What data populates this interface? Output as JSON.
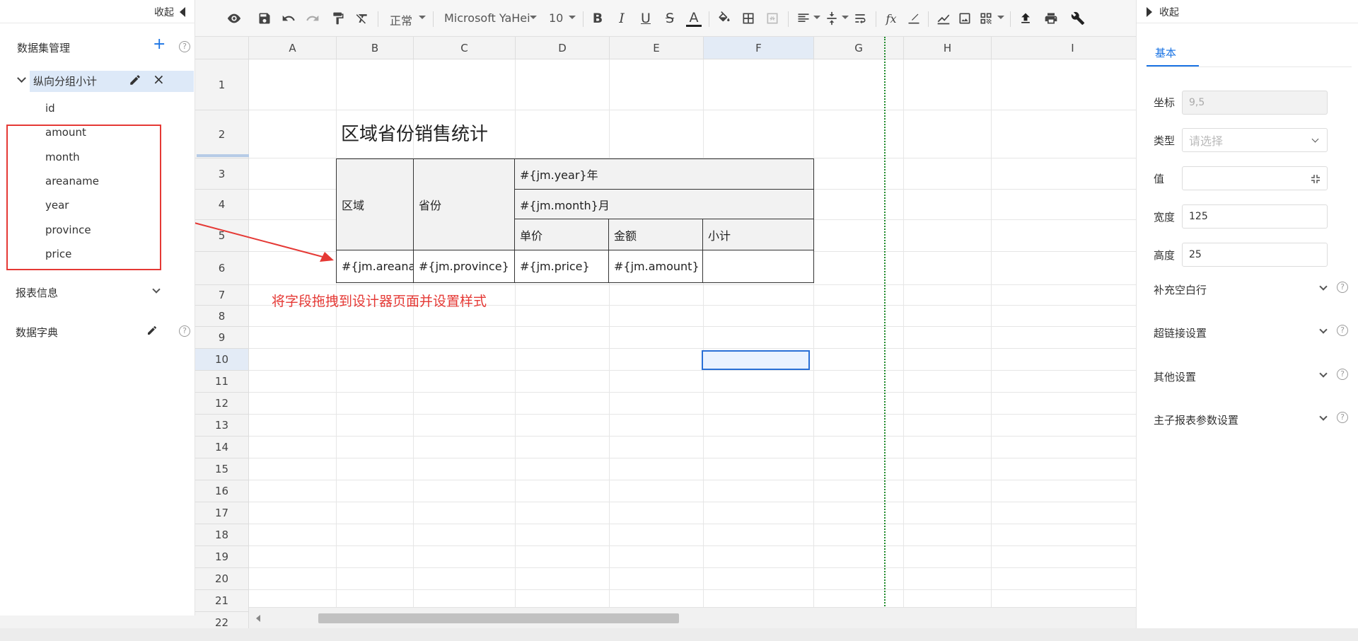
{
  "left_panel": {
    "collapse_label": "收起",
    "dataset_header": "数据集管理",
    "dataset_name": "纵向分组小计",
    "fields": [
      "id",
      "amount",
      "month",
      "areaname",
      "year",
      "province",
      "price"
    ],
    "report_info": "报表信息",
    "data_dictionary": "数据字典"
  },
  "toolbar": {
    "style_select": "正常",
    "font_select": "Microsoft YaHei",
    "size_select": "10"
  },
  "sheet": {
    "columns": [
      "A",
      "B",
      "C",
      "D",
      "E",
      "F",
      "G",
      "H",
      "I"
    ],
    "rows": [
      "1",
      "2",
      "3",
      "4",
      "5",
      "6",
      "7",
      "8",
      "9",
      "10",
      "11",
      "12",
      "13",
      "14",
      "15",
      "16",
      "17",
      "18",
      "19",
      "20",
      "21",
      "22"
    ],
    "selected_column": "F",
    "selected_row": "10",
    "title": "区域省份销售统计",
    "header_area": "区域",
    "header_province": "省份",
    "header_year": "#{jm.year}年",
    "header_month": "#{jm.month}月",
    "header_price": "单价",
    "header_amount": "金额",
    "header_subtotal": "小计",
    "data_area": "#{jm.areana",
    "data_province": "#{jm.province}",
    "data_price": "#{jm.price}",
    "data_amount": "#{jm.amount}",
    "annotation": "将字段拖拽到设计器页面并设置样式"
  },
  "right_panel": {
    "collapse_label": "收起",
    "tab_basic": "基本",
    "label_coord": "坐标",
    "coord_value": "9,5",
    "label_type": "类型",
    "type_placeholder": "请选择",
    "label_value": "值",
    "label_width": "宽度",
    "width_value": "125",
    "label_height": "高度",
    "height_value": "25",
    "section_blank_rows": "补充空白行",
    "section_hyperlink": "超链接设置",
    "section_other": "其他设置",
    "section_params": "主子报表参数设置"
  },
  "colors": {
    "accent": "#1b74e4",
    "annotation_red": "#e53935",
    "freeze_line": "#1e8a2a"
  }
}
